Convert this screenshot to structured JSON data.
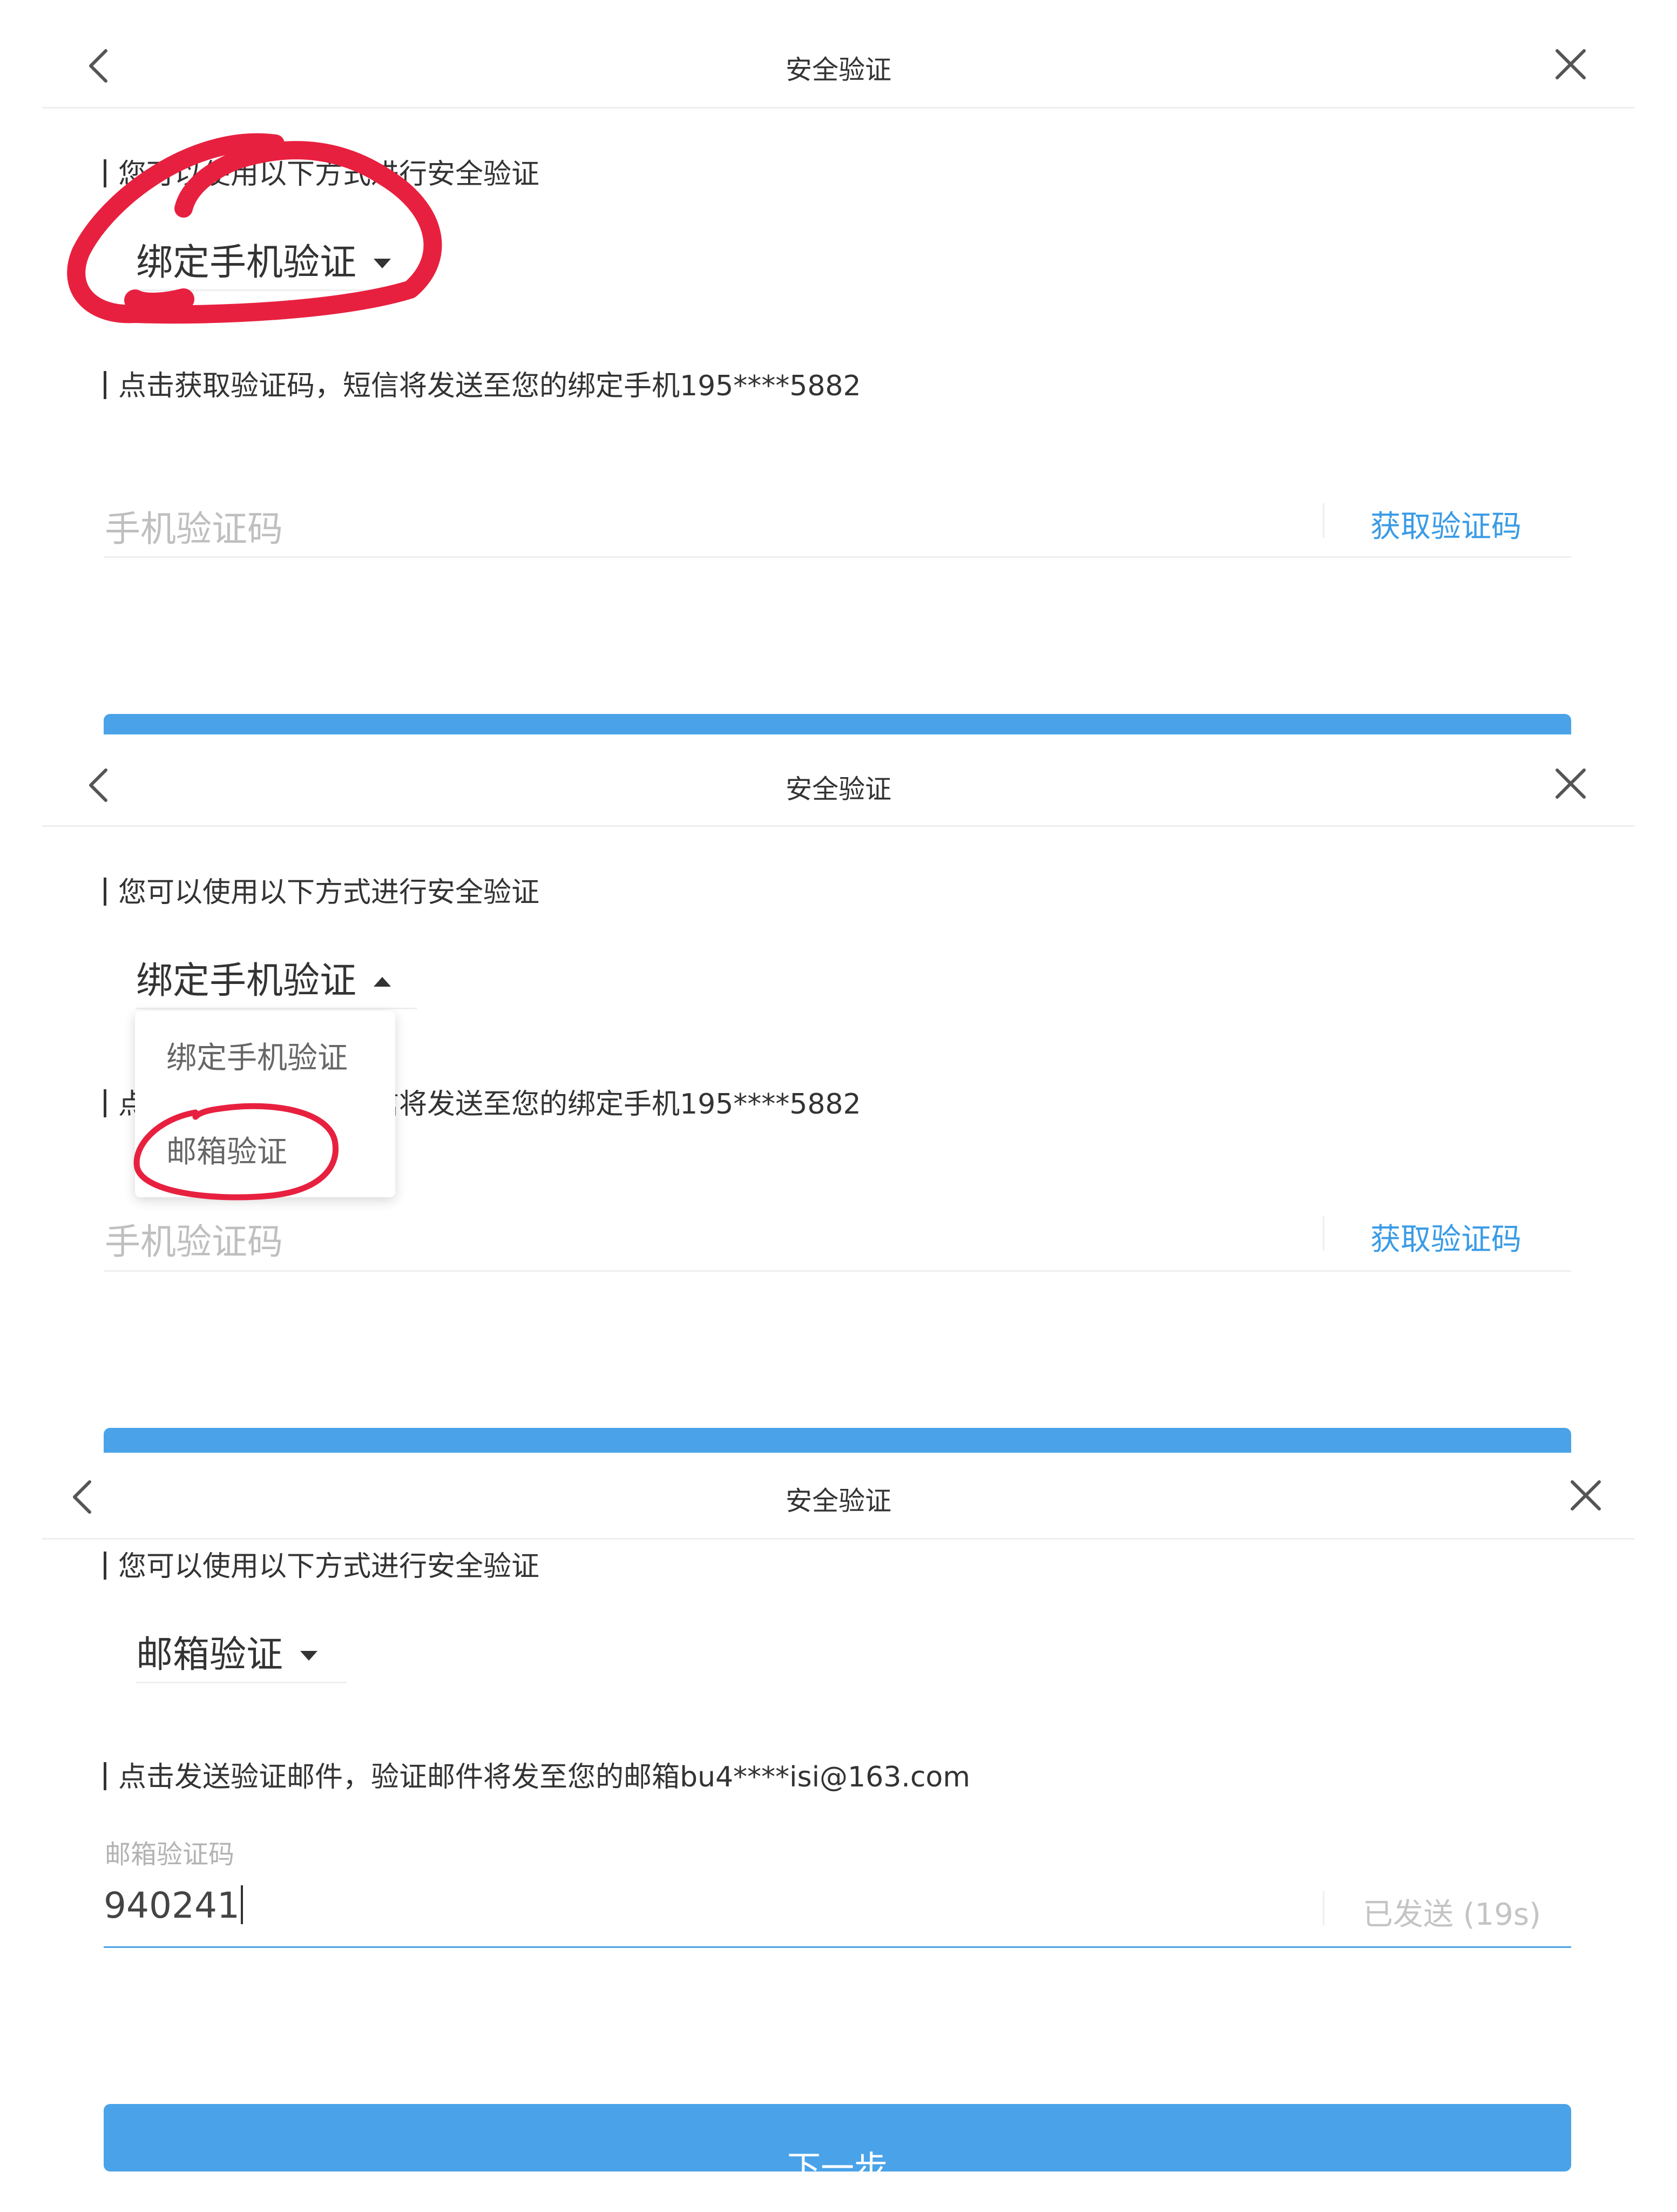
{
  "panels": [
    {
      "title": "安全验证",
      "intro": "您可以使用以下方式进行安全验证",
      "method": "绑定手机验证",
      "hint": "点击获取验证码，短信将发送至您的绑定手机195****5882",
      "code_placeholder": "手机验证码",
      "get_code": "获取验证码"
    },
    {
      "title": "安全验证",
      "intro": "您可以使用以下方式进行安全验证",
      "method": "绑定手机验证",
      "hint": "点击获取验证码，短信将发送至您的绑定手机195****5882",
      "code_placeholder": "手机验证码",
      "get_code": "获取验证码",
      "dropdown_options": [
        "绑定手机验证",
        "邮箱验证"
      ]
    },
    {
      "title": "安全验证",
      "intro": "您可以使用以下方式进行安全验证",
      "method": "邮箱验证",
      "hint": "点击发送验证邮件，验证邮件将发至您的邮箱bu4****isi@163.com",
      "code_label": "邮箱验证码",
      "code_value": "940241",
      "resend_status": "已发送 (19s)",
      "next_button": "下一步"
    }
  ],
  "colors": {
    "accent": "#4aa3e8",
    "link": "#3a9be6",
    "annotation": "#e8203f"
  },
  "icons": {
    "back": "chevron-left-icon",
    "close": "close-icon",
    "dropdown": "caret-down-icon"
  }
}
